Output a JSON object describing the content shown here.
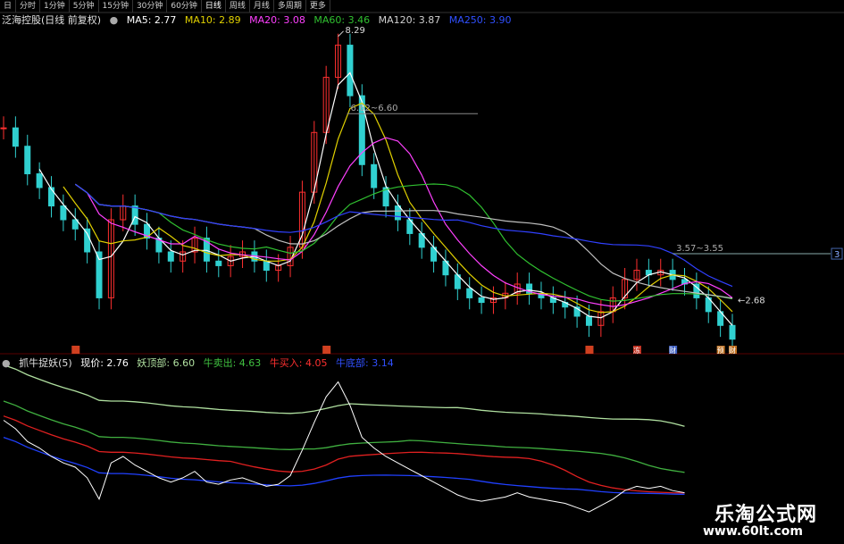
{
  "tabs": [
    "日",
    "分时",
    "1分钟",
    "5分钟",
    "15分钟",
    "30分钟",
    "60分钟",
    "日线",
    "周线",
    "月线",
    "多周期",
    "更多"
  ],
  "active_tab_index": 7,
  "top_legend": {
    "title": "泛海控股(日线 前复权)",
    "ma5": "MA5: 2.77",
    "ma10": "MA10: 2.89",
    "ma20": "MA20: 3.08",
    "ma60": "MA60: 3.46",
    "ma120": "MA120: 3.87",
    "ma250": "MA250: 3.90",
    "arrow": "↓"
  },
  "bottom_legend": {
    "indicator": "抓牛捉妖(5)",
    "price": "现价: 2.76",
    "top_line": "妖顶部: 6.60",
    "sell_line": "牛卖出: 4.63",
    "buy_line": "牛买入: 4.05",
    "bottom_line": "牛底部: 3.14"
  },
  "annotations": {
    "high_label": "8.29",
    "level_label": "6.62~6.60",
    "mid_label": "3.57~3.55",
    "low_label": "2.68",
    "right_axis_tag": "3"
  },
  "event_markers": [
    {
      "text": "",
      "color": "#d04020"
    },
    {
      "text": "",
      "color": "#d04020"
    },
    {
      "text": "",
      "color": "#d04020"
    },
    {
      "text": "冻",
      "color": "#c03020"
    },
    {
      "text": "财",
      "color": "#4060c0"
    },
    {
      "text": "预",
      "color": "#c07020"
    },
    {
      "text": "财",
      "color": "#c07020"
    }
  ],
  "watermark": {
    "cn": "乐淘公式网",
    "url": "www.60lt.com"
  },
  "colors": {
    "ma5": "#ffffff",
    "ma10": "#e0d000",
    "ma20": "#ff40ff",
    "ma60": "#30c030",
    "ma120": "#c0c0c0",
    "ma250": "#3040ff",
    "up": "#ff3030",
    "down": "#30d0d0",
    "osc_top": "#b0e0a0",
    "osc_sell": "#40b040",
    "osc_buy": "#e02020",
    "osc_bottom": "#2040ff",
    "osc_price": "#ffffff"
  },
  "chart_data": [
    {
      "type": "candlestick",
      "title": "泛海控股(日线 前复权)",
      "series": [
        {
          "name": "MA5",
          "last": 2.77
        },
        {
          "name": "MA10",
          "last": 2.89
        },
        {
          "name": "MA20",
          "last": 3.08
        },
        {
          "name": "MA60",
          "last": 3.46
        },
        {
          "name": "MA120",
          "last": 3.87
        },
        {
          "name": "MA250",
          "last": 3.9
        }
      ],
      "close": [
        6.3,
        5.9,
        5.3,
        5.0,
        4.6,
        4.3,
        4.1,
        3.6,
        2.6,
        4.3,
        4.6,
        4.2,
        3.9,
        3.6,
        3.4,
        3.6,
        3.9,
        3.4,
        3.3,
        3.5,
        3.6,
        3.4,
        3.2,
        3.3,
        3.7,
        4.9,
        6.2,
        7.4,
        8.1,
        7.0,
        5.5,
        5.0,
        4.6,
        4.3,
        4.0,
        3.7,
        3.4,
        3.1,
        2.8,
        2.6,
        2.5,
        2.6,
        2.7,
        2.9,
        2.7,
        2.6,
        2.5,
        2.4,
        2.2,
        2.0,
        2.3,
        2.6,
        3.0,
        3.2,
        3.1,
        3.2,
        3.0,
        2.9,
        2.6,
        2.3,
        2.0,
        1.7
      ],
      "ylim": [
        1.5,
        8.5
      ],
      "high": 8.29,
      "low": 2.68
    },
    {
      "type": "line",
      "title": "抓牛捉妖(5)",
      "series": [
        {
          "name": "现价",
          "last": 2.76,
          "values": [
            6.3,
            5.9,
            5.3,
            5.0,
            4.6,
            4.3,
            4.1,
            3.6,
            2.6,
            4.3,
            4.6,
            4.2,
            3.9,
            3.6,
            3.4,
            3.6,
            3.9,
            3.4,
            3.3,
            3.5,
            3.6,
            3.4,
            3.2,
            3.3,
            3.7,
            4.9,
            6.2,
            7.4,
            8.1,
            7.0,
            5.5,
            5.0,
            4.6,
            4.3,
            4.0,
            3.7,
            3.4,
            3.1,
            2.8,
            2.6,
            2.5,
            2.6,
            2.7,
            2.9,
            2.7,
            2.6,
            2.5,
            2.4,
            2.2,
            2.0,
            2.3,
            2.6,
            3.0,
            3.2,
            3.1,
            3.2,
            3.0,
            2.9,
            2.6,
            2.3,
            2.0,
            1.7
          ]
        },
        {
          "name": "妖顶部",
          "last": 6.6
        },
        {
          "name": "牛卖出",
          "last": 4.63
        },
        {
          "name": "牛买入",
          "last": 4.05
        },
        {
          "name": "牛底部",
          "last": 3.14
        }
      ]
    }
  ]
}
